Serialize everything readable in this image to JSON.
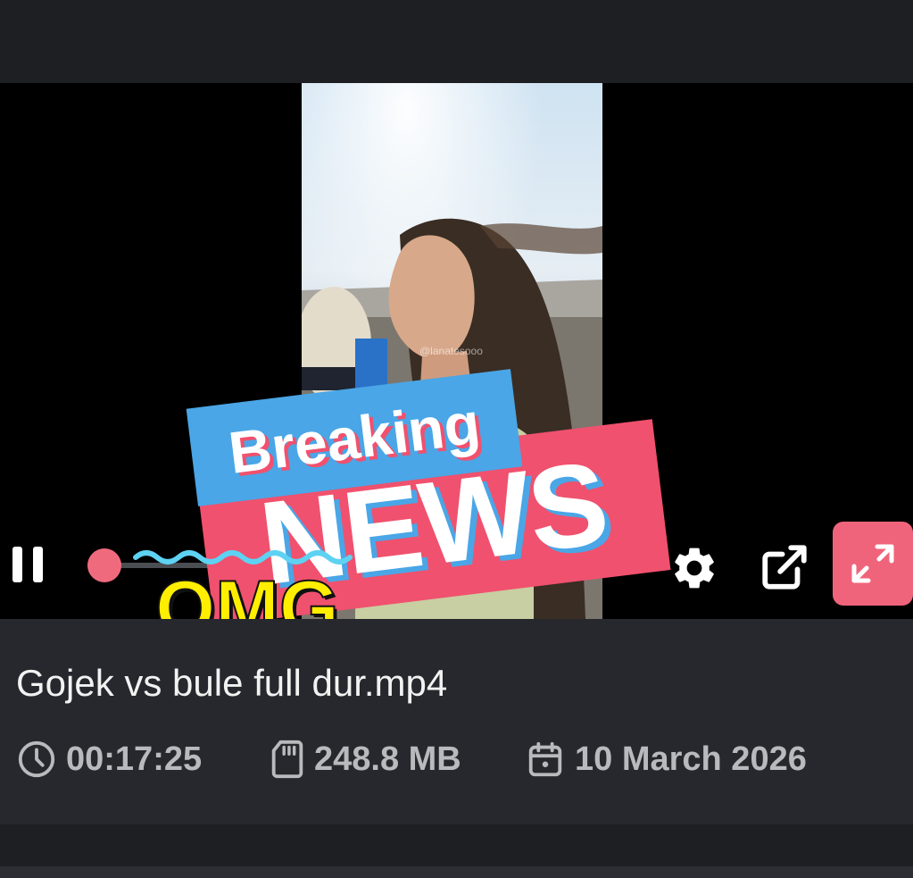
{
  "player": {
    "watermark": "@lanatesooo",
    "progress_fraction": 0.02,
    "icons": {
      "pause": "pause-icon",
      "settings": "gear-icon",
      "popout": "external-link-icon",
      "fullscreen": "expand-icon"
    }
  },
  "stickers": {
    "breaking": "Breaking",
    "news": "NEWS",
    "omg": "OMG"
  },
  "file": {
    "title": "Gojek vs bule full dur.mp4",
    "duration": "00:17:25",
    "size": "248.8 MB",
    "date": "10 March 2026"
  },
  "colors": {
    "accent": "#f0647b",
    "sticker_blue": "#4aa6e6",
    "sticker_pink": "#f0516e",
    "omg_yellow": "#ffee00",
    "panel_bg": "#26282d",
    "meta_text": "#b8babd"
  }
}
